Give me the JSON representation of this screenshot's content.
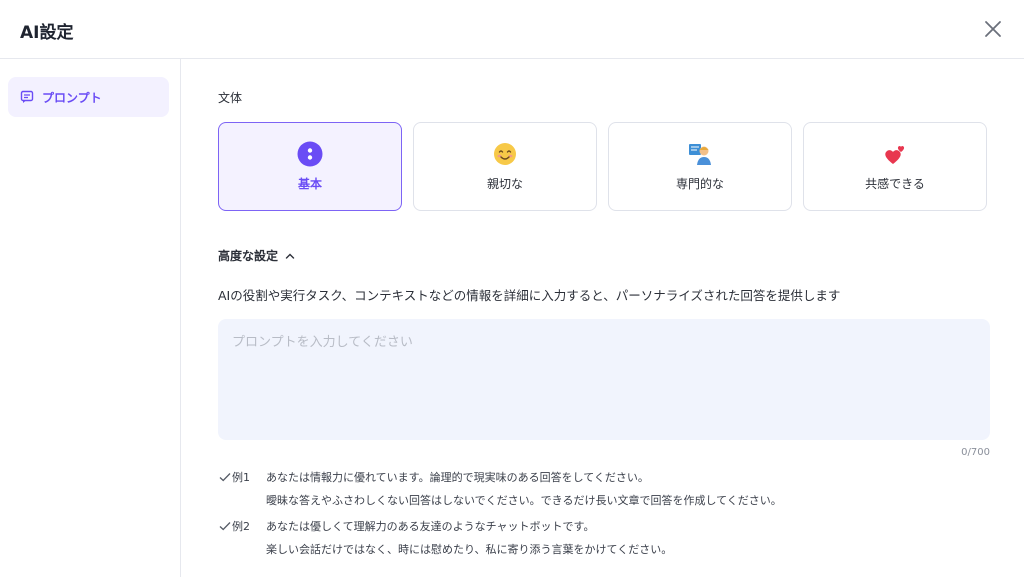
{
  "dialog": {
    "title": "AI設定"
  },
  "sidebar": {
    "items": [
      {
        "label": "プロンプト",
        "icon": "chat-icon",
        "active": true
      }
    ]
  },
  "main": {
    "style_label": "文体",
    "styles": [
      {
        "label": "基本",
        "icon": "dots-icon",
        "selected": true
      },
      {
        "label": "親切な",
        "icon": "smile-emoji"
      },
      {
        "label": "専門的な",
        "icon": "teacher-emoji"
      },
      {
        "label": "共感できる",
        "icon": "hearts-emoji"
      }
    ],
    "advanced_label": "高度な設定",
    "description": "AIの役割や実行タスク、コンテキストなどの情報を詳細に入力すると、パーソナライズされた回答を提供します",
    "prompt": {
      "placeholder": "プロンプトを入力してください",
      "value": "",
      "counter": "0/700"
    },
    "examples": [
      {
        "tag": "例1",
        "lines": [
          "あなたは情報力に優れています。論理的で現実味のある回答をしてください。",
          "曖昧な答えやふさわしくない回答はしないでください。できるだけ長い文章で回答を作成してください。"
        ]
      },
      {
        "tag": "例2",
        "lines": [
          "あなたは優しくて理解力のある友達のようなチャットボットです。",
          "楽しい会話だけではなく、時には慰めたり、私に寄り添う言葉をかけてください。"
        ]
      }
    ]
  },
  "colors": {
    "accent": "#6a4cf5",
    "accent_bg": "#f3f1ff",
    "input_bg": "#f1f4fd",
    "border": "#e6e8ee"
  }
}
